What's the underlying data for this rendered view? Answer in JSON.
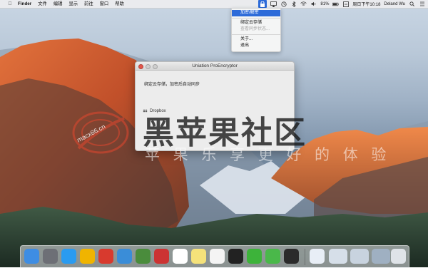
{
  "menubar": {
    "app_name": "Finder",
    "items": [
      "文件",
      "编辑",
      "显示",
      "前往",
      "窗口",
      "帮助"
    ],
    "battery": "81%",
    "datetime": "周日下午10:18",
    "user": "Deland Wu"
  },
  "dropdown": {
    "items": [
      {
        "label": "加密/解密",
        "state": "selected"
      },
      {
        "label": "绑定云存储",
        "state": "normal"
      },
      {
        "label": "查看同步状态...",
        "state": "disabled"
      },
      {
        "label": "关于...",
        "state": "normal"
      },
      {
        "label": "退出",
        "state": "normal"
      }
    ]
  },
  "window": {
    "title": "Uniation ProEncryptor",
    "message": "绑定云存储，加密后自动同步",
    "dropbox_label": "Dropbox"
  },
  "watermark": {
    "title": "黑苹果社区",
    "url": "macx86.cn",
    "subtitle_line": "苹 果 乐 享 更 好 的 体 验"
  },
  "dock": {
    "apps": [
      {
        "name": "finder-icon",
        "color": "#3e8de3"
      },
      {
        "name": "launchpad-icon",
        "color": "#6d6f76"
      },
      {
        "name": "safari-icon",
        "color": "#2a9bf0"
      },
      {
        "name": "chrome-icon",
        "color": "#f0b400"
      },
      {
        "name": "app-store-icon-red",
        "color": "#d83a2e"
      },
      {
        "name": "xcode-icon",
        "color": "#3a8dd8"
      },
      {
        "name": "android-studio-icon",
        "color": "#4a8c3c"
      },
      {
        "name": "photo-booth-icon",
        "color": "#cc3333"
      },
      {
        "name": "calendar-icon",
        "color": "#ffffff"
      },
      {
        "name": "notes-icon",
        "color": "#f5e27a"
      },
      {
        "name": "reminders-icon",
        "color": "#f4f4f4"
      },
      {
        "name": "qq-icon",
        "color": "#222222"
      },
      {
        "name": "wechat-icon",
        "color": "#3db33a"
      },
      {
        "name": "evernote-icon",
        "color": "#4ab84a"
      },
      {
        "name": "terminal-icon",
        "color": "#2b2b2b"
      },
      {
        "name": "downloads-icon",
        "color": "#e8eef6"
      },
      {
        "name": "screenshot-stack-1",
        "color": "#d6dfe9"
      },
      {
        "name": "screenshot-stack-2",
        "color": "#c8d3df"
      },
      {
        "name": "screenshot-stack-3",
        "color": "#9fb0c2"
      },
      {
        "name": "trash-icon",
        "color": "#dfe3e8"
      }
    ]
  }
}
